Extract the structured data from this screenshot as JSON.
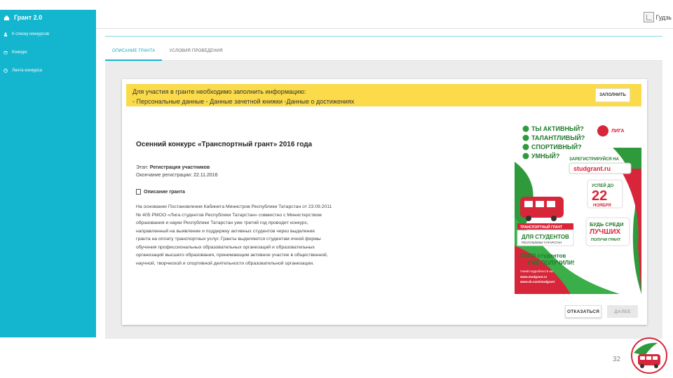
{
  "app": {
    "title": "Грант 2.0"
  },
  "sidebar": {
    "items": [
      {
        "label": "К списку конкурсов",
        "icon": "person-icon"
      },
      {
        "label": "Конкурс",
        "icon": "calendar-icon"
      },
      {
        "label": "Лента конкурса",
        "icon": "clock-icon"
      }
    ]
  },
  "user": {
    "name": "Гудзь"
  },
  "tabs": [
    {
      "label": "Описание гранта",
      "active": true
    },
    {
      "label": "Условия проведения",
      "active": false
    }
  ],
  "notice": {
    "line1": "Для участия в гранте необходимо заполнить информацию:",
    "line2": "- Персональные данные - Данные зачетной книжки -Данные о достижениях",
    "button": "ЗАПОЛНИТЬ"
  },
  "competition": {
    "title": "Осенний конкурс «Транспортный грант» 2016 года",
    "stage_label": "Этап:",
    "stage_value": "Регистрация участников",
    "end_label": "Окончание регистрации:",
    "end_value": "22.11.2016",
    "description_heading": "Описание гранта",
    "description_lines": [
      "На основании Постановления Кабинета Министров Республики Татарстан от 23.09.2011",
      "№ 405 РМОО «Лига студентов Республики Татарстан» совместно с Министерством",
      "образования и науки Республики Татарстан уже третий год проводит конкурс,",
      "направленный на выявление и поддержку активных студентов через выделение",
      "гранта на оплату транспортных услуг. Гранты выделяются студентам очной формы",
      "обучения профессиональных образовательных организаций и образовательных",
      "организаций высшего образования, принимающим активное участие в общественной,",
      "научной, творческой и спортивной деятельности образовательной организации."
    ]
  },
  "poster": {
    "q1": "ТЫ АКТИВНЫЙ?",
    "q2": "ТАЛАНТЛИВЫЙ?",
    "q3": "СПОРТИВНЫЙ?",
    "q4": "УМНЫЙ?",
    "register": "ЗАРЕГИСТРИРУЙСЯ НА",
    "site": "studgrant.ru",
    "hurry": "УСПЕЙ ДО",
    "day": "22",
    "month": "НОЯБРЯ",
    "grant_label": "ТРАНСПОРТНЫЙ ГРАНТ",
    "for_students": "ДЛЯ СТУДЕНТОВ",
    "republic": "РЕСПУБЛИКИ ТАТАРСТАН",
    "be_among": "БУДЬ СРЕДИ",
    "best": "ЛУЧШИХ",
    "got_grant": "ПОЛУЧИ ГРАНТ",
    "count": "33000 студентов",
    "received": "УЖЕ ПОЛУЧИЛИ!",
    "details": "Узнай подробности на:",
    "link1": "www.studgrant.ru",
    "link2": "www.vk.com/studgrant",
    "logo_text": "ЛИГА"
  },
  "actions": {
    "cancel": "ОТКАЗАТЬСЯ",
    "next": "ДАЛЕЕ"
  },
  "page_number": "32",
  "colors": {
    "sidebar": "#13b5cf",
    "notice": "#fbdb49",
    "accent": "#13b5cf"
  }
}
